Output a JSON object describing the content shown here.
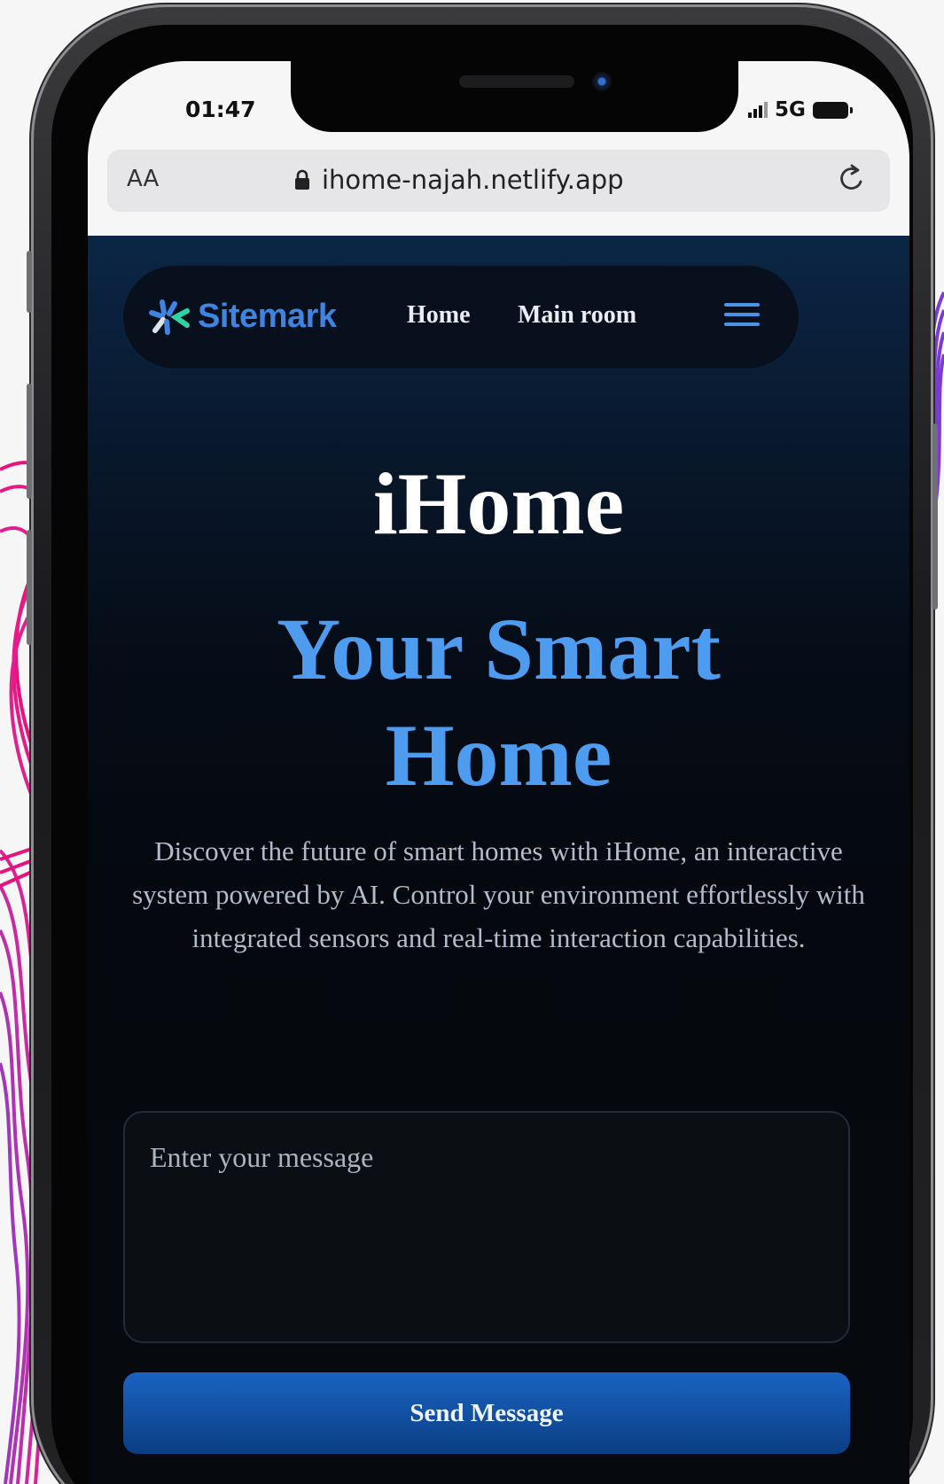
{
  "status_bar": {
    "time": "01:47",
    "network": "5G"
  },
  "browser": {
    "text_size_label": "AA",
    "url": "ihome-najah.netlify.app",
    "lock_icon": "lock-icon",
    "reload_icon": "reload-icon"
  },
  "site": {
    "brand": "Sitemark",
    "nav": {
      "home": "Home",
      "main_room": "Main room",
      "menu_icon": "hamburger-icon"
    },
    "hero": {
      "title": "iHome",
      "subtitle": "Your Smart Home",
      "description": "Discover the future of smart homes with iHome, an interactive system powered by AI. Control your environment effortlessly with integrated sensors and real-time interaction capabilities."
    },
    "form": {
      "message_placeholder": "Enter your message",
      "send_label": "Send Message"
    }
  },
  "colors": {
    "accent": "#4d9cf0",
    "brand_green": "#2fd3a3",
    "button": "#1a63c2",
    "decor_pink": "#e6127e",
    "decor_purple": "#7b39d6"
  }
}
